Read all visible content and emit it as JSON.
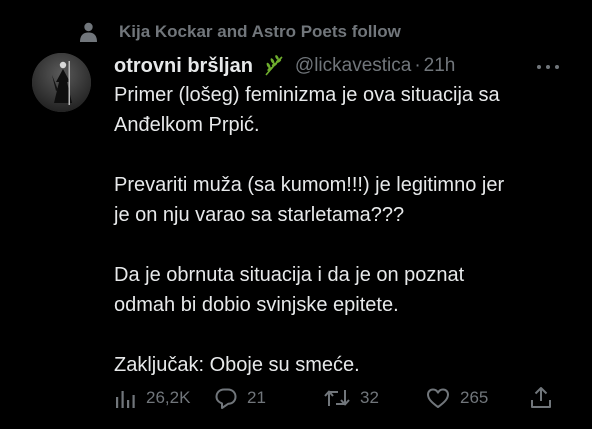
{
  "social_context": {
    "text": "Kija Kockar and Astro Poets follow",
    "icon": "person-icon"
  },
  "tweet": {
    "author": {
      "display_name": "otrovni bršljan",
      "name_emoji": "herb-leaf-icon",
      "handle": "@lickavestica",
      "separator": "·",
      "time": "21h"
    },
    "paragraphs": [
      "Primer (lošeg) feminizma je ova situacija sa\nAnđelkom Prpić.",
      "Prevariti muža (sa kumom!!!) je legitimno jer\nje on nju varao sa starletama???",
      "Da je obrnuta situacija i da je on poznat\nodmah bi dobio svinjske epitete.",
      "Zaključak: Oboje su smeće."
    ],
    "actions": {
      "views": "26,2K",
      "replies": "21",
      "retweets": "32",
      "likes": "265"
    }
  },
  "colors": {
    "background": "#000000",
    "primary_text": "#e7e9ea",
    "secondary_text": "#71767b",
    "leaf_green": "#6fae2e"
  }
}
